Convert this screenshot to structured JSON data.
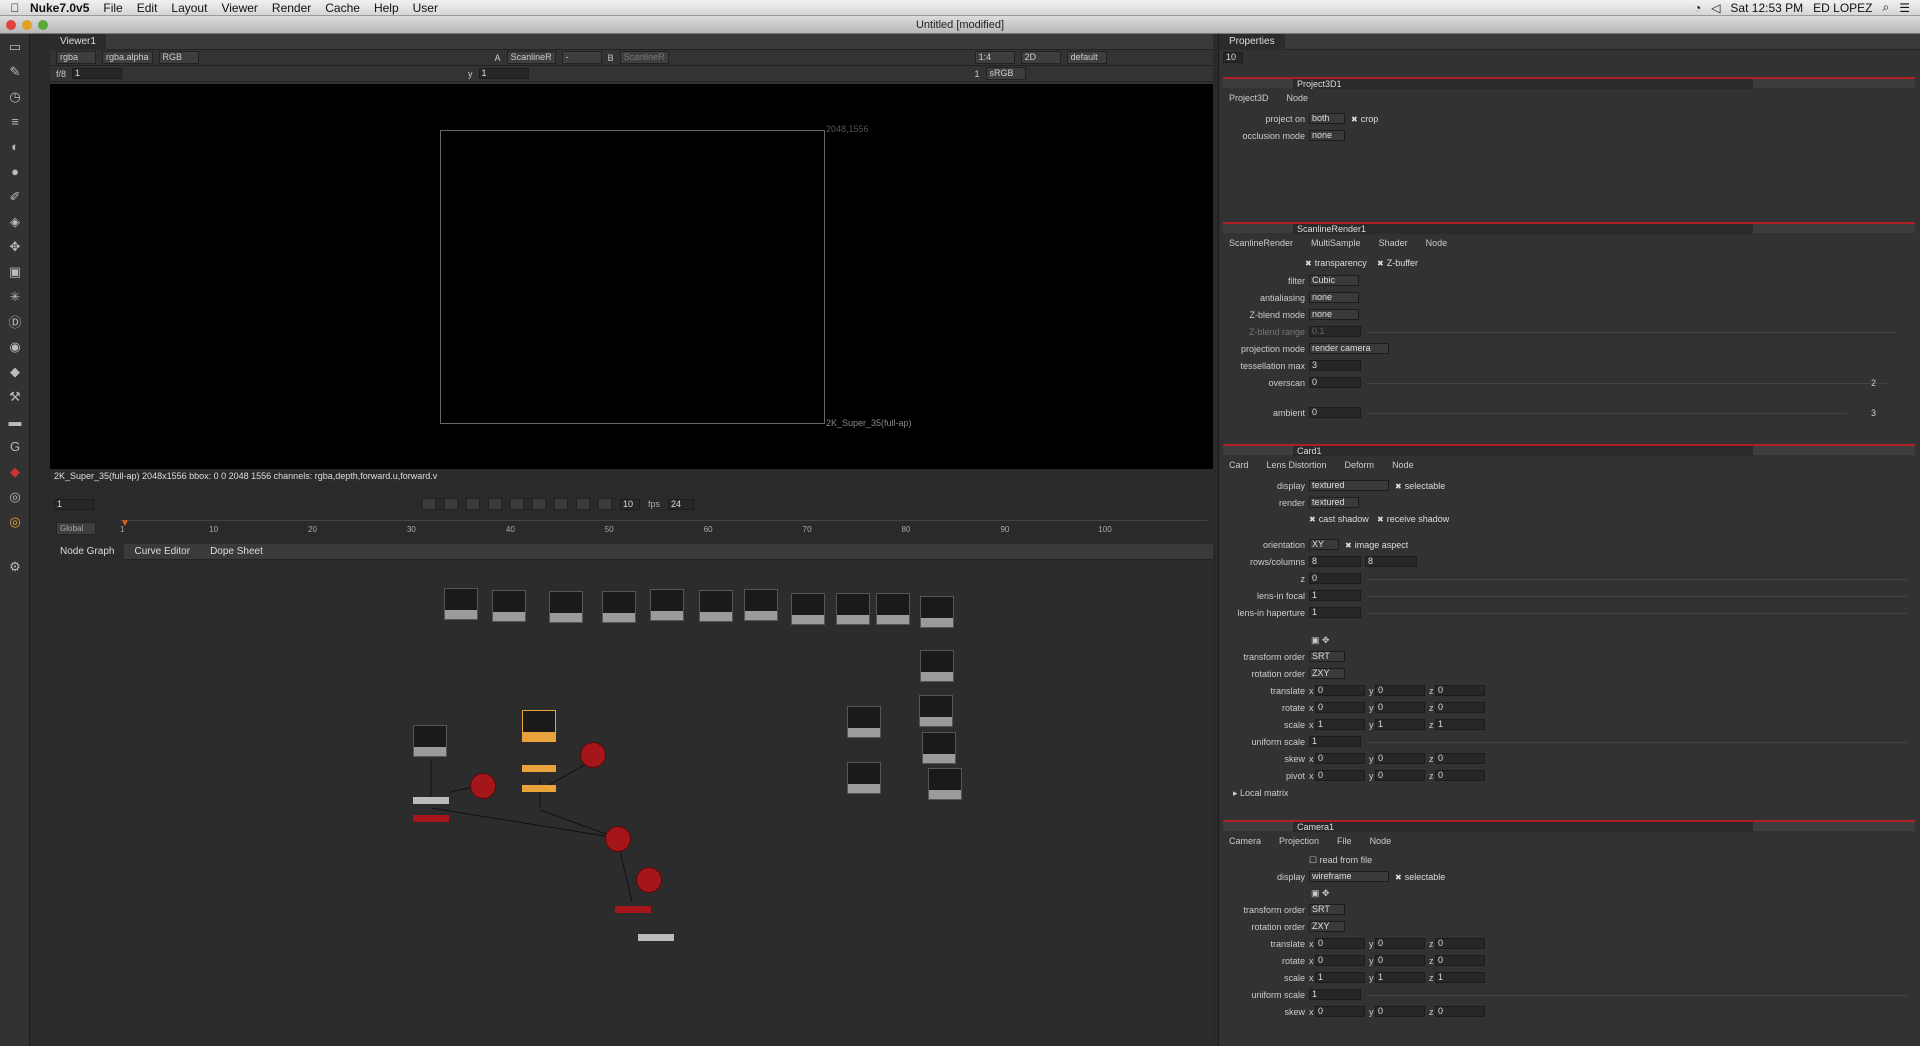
{
  "menubar": {
    "app": "Nuke7.0v5",
    "items": [
      "File",
      "Edit",
      "Layout",
      "Viewer",
      "Render",
      "Cache",
      "Help",
      "User"
    ],
    "clock": "Sat 12:53 PM",
    "user": "ED LOPEZ"
  },
  "window": {
    "title": "Untitled [modified]"
  },
  "viewer": {
    "tab": "Viewer1",
    "channels": "rgba",
    "alpha": "rgba.alpha",
    "display": "RGB",
    "a_input": "ScanlineR",
    "ab_op": "-",
    "b_input": "ScanlineR",
    "zoom": "1:4",
    "mode": "2D",
    "lut_default": "default",
    "fstop": "f/8",
    "gain": "1",
    "y_label": "y",
    "gamma": "1",
    "frame_field": "1",
    "lut": "sRGB",
    "corner_tr": "2048,1556",
    "format_label": "2K_Super_35(full-ap)",
    "info": "2K_Super_35(full-ap) 2048x1556 bbox: 0 0 2048 1556 channels: rgba,depth,forward.u,forward.v"
  },
  "transport": {
    "frame": "1",
    "step": "10",
    "fps_label": "fps",
    "fps": "24",
    "range_mode": "Global",
    "ticks": [
      "1",
      "10",
      "20",
      "30",
      "40",
      "50",
      "60",
      "70",
      "80",
      "90",
      "100"
    ],
    "end": "100"
  },
  "graph_tabs": [
    "Node Graph",
    "Curve Editor",
    "Dope Sheet"
  ],
  "properties": {
    "tab": "Properties",
    "max_panels": "10",
    "project3d": {
      "name": "Project3D1",
      "tabs": [
        "Project3D",
        "Node"
      ],
      "project_on_label": "project on",
      "project_on": "both",
      "crop": "crop",
      "occlusion_label": "occlusion mode",
      "occlusion": "none"
    },
    "scanline": {
      "name": "ScanlineRender1",
      "tabs": [
        "ScanlineRender",
        "MultiSample",
        "Shader",
        "Node"
      ],
      "transparency": "transparency",
      "zbuffer": "Z-buffer",
      "filter_label": "filter",
      "filter": "Cubic",
      "aa_label": "antialiasing",
      "aa": "none",
      "zblend_label": "Z-blend mode",
      "zblend": "none",
      "zrange_label": "Z-blend range",
      "zrange": "0.1",
      "proj_label": "projection mode",
      "proj": "render camera",
      "tess_label": "tessellation max",
      "tess": "3",
      "overscan_label": "overscan",
      "overscan": "0",
      "overscan_max": "2",
      "ambient_label": "ambient",
      "ambient": "0",
      "ambient_n": "3"
    },
    "card": {
      "name": "Card1",
      "tabs": [
        "Card",
        "Lens Distortion",
        "Deform",
        "Node"
      ],
      "display_label": "display",
      "display": "textured",
      "selectable": "selectable",
      "render_label": "render",
      "render": "textured",
      "cast": "cast shadow",
      "receive": "receive shadow",
      "orient_label": "orientation",
      "orient": "XY",
      "image_aspect": "image aspect",
      "rows_label": "rows/columns",
      "rows": "8",
      "cols": "8",
      "z_label": "z",
      "z": "0",
      "focal_label": "lens-in focal",
      "focal": "1",
      "hap_label": "lens-in haperture",
      "hap": "1",
      "to_label": "transform order",
      "to": "SRT",
      "ro_label": "rotation order",
      "ro": "ZXY",
      "translate_label": "translate",
      "rotate_label": "rotate",
      "scale_label": "scale",
      "us_label": "uniform scale",
      "us": "1",
      "skew_label": "skew",
      "pivot_label": "pivot",
      "local": "Local matrix",
      "x": "x",
      "y": "y",
      "z_axis": "z",
      "zero": "0",
      "one": "1"
    },
    "camera": {
      "name": "Camera1",
      "tabs": [
        "Camera",
        "Projection",
        "File",
        "Node"
      ],
      "read": "read from file",
      "display_label": "display",
      "display": "wireframe",
      "selectable": "selectable",
      "to_label": "transform order",
      "to": "SRT",
      "ro_label": "rotation order",
      "ro": "ZXY",
      "translate_label": "translate",
      "rotate_label": "rotate",
      "scale_label": "scale",
      "us_label": "uniform scale",
      "us": "1",
      "skew_label": "skew"
    }
  }
}
